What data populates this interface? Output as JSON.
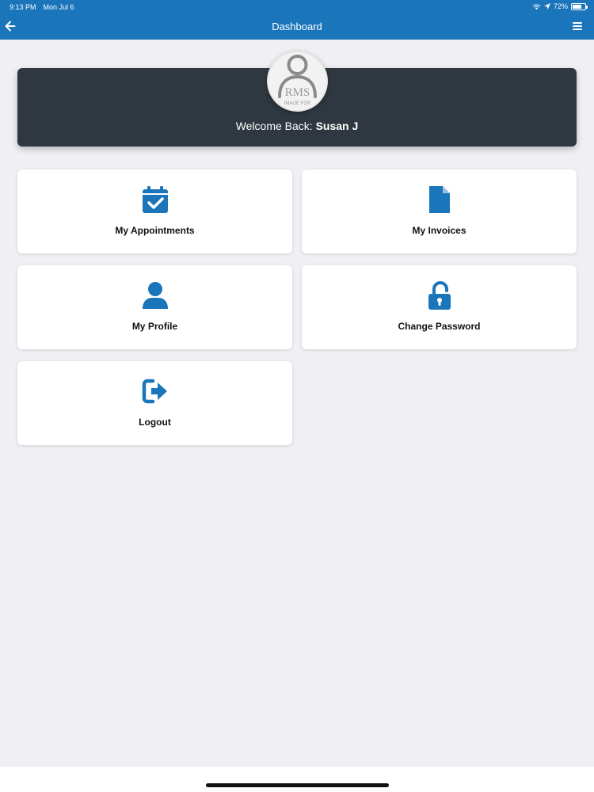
{
  "status_bar": {
    "time": "9:13 PM",
    "date": "Mon Jul 6",
    "battery": "72%",
    "battery_level": 0.72
  },
  "nav": {
    "title": "Dashboard",
    "back_icon": "arrow-left-icon",
    "menu_icon": "hamburger-menu-icon"
  },
  "welcome": {
    "prefix": "Welcome Back:",
    "user_name": "Susan J",
    "avatar_logo_text": "RMS",
    "avatar_logo_subtext": "IMAGE FOR"
  },
  "tiles": [
    {
      "label": "My Appointments",
      "icon": "calendar-check-icon"
    },
    {
      "label": "My Invoices",
      "icon": "file-icon"
    },
    {
      "label": "My Profile",
      "icon": "user-icon"
    },
    {
      "label": "Change Password",
      "icon": "unlock-icon"
    },
    {
      "label": "Logout",
      "icon": "sign-out-icon"
    }
  ],
  "colors": {
    "brand": "#1a75bb",
    "card_dark": "#2f3840",
    "background": "#efeff4"
  }
}
